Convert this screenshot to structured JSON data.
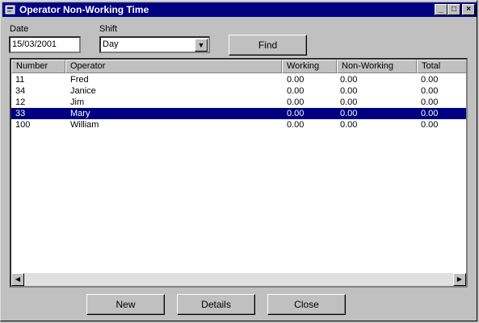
{
  "window": {
    "title": "Operator Non-Working Time"
  },
  "titlebar_buttons": {
    "minimize": "_",
    "maximize": "□",
    "close": "×"
  },
  "form": {
    "date_label": "Date",
    "date_value": "15/03/2001",
    "shift_label": "Shift",
    "shift_value": "Day",
    "find_button": "Find"
  },
  "table": {
    "columns": [
      "Number",
      "Operator",
      "Working",
      "Non-Working",
      "Total"
    ],
    "rows": [
      [
        "11",
        "Fred",
        "0.00",
        "0.00",
        "0.00"
      ],
      [
        "34",
        "Janice",
        "0.00",
        "0.00",
        "0.00"
      ],
      [
        "12",
        "Jim",
        "0.00",
        "0.00",
        "0.00"
      ],
      [
        "33",
        "Mary",
        "0.00",
        "0.00",
        "0.00"
      ],
      [
        "100",
        "William",
        "0.00",
        "0.00",
        "0.00"
      ]
    ],
    "selected_row": 3
  },
  "buttons": {
    "new": "New",
    "details": "Details",
    "close": "Close"
  },
  "colors": {
    "titlebar": "#000080",
    "face": "#c0c0c0",
    "selection": "#000080"
  }
}
